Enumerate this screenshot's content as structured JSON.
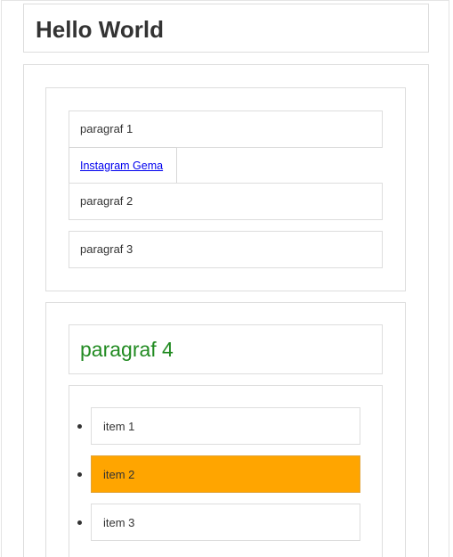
{
  "header": {
    "title": "Hello World"
  },
  "section1": {
    "paragraph_1": "paragraf 1",
    "link_text": "Instagram Gema",
    "paragraph_2": "paragraf 2",
    "paragraph_3": "paragraf 3"
  },
  "section2": {
    "heading": "paragraf 4",
    "items": [
      "item 1",
      "item 2",
      "item 3"
    ]
  },
  "colors": {
    "heading_green": "#228b22",
    "highlight_orange": "#ffa500",
    "link_blue": "#0000ee"
  }
}
